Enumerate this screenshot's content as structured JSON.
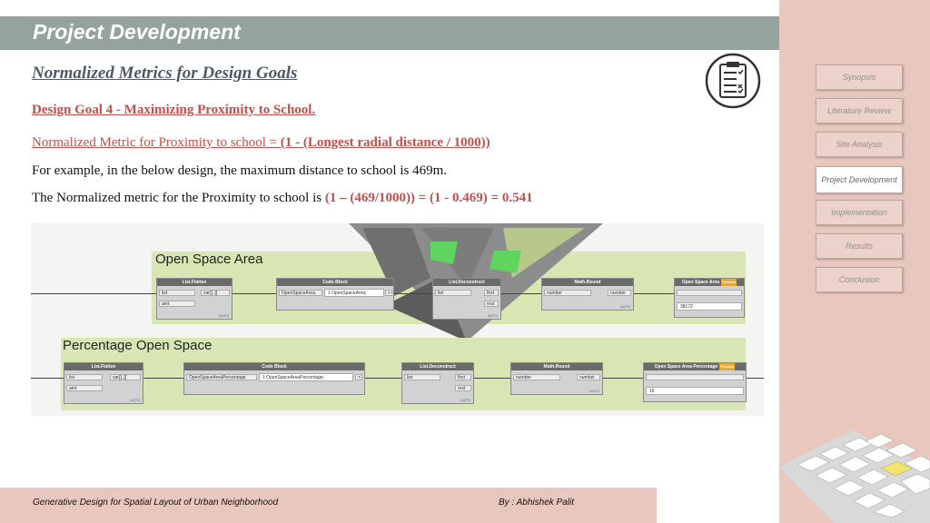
{
  "header": {
    "title": "Project Development"
  },
  "slide": {
    "subtitle": "Normalized Metrics for Design Goals",
    "goal": "Design Goal 4 - Maximizing Proximity to School.",
    "metric_prefix": "Normalized Metric for Proximity to school = ",
    "metric_formula": "(1 - (Longest radial distance / 1000))",
    "example": "For example, in the below design, the maximum distance to school is 469m.",
    "result_prefix": "The Normalized metric for the Proximity to school is ",
    "result_value": "(1 – (469/1000)) = (1 - 0.469) = 0.541"
  },
  "nav": {
    "items": [
      "Synopsis",
      "Literature Review",
      "Site Analysis",
      "Project Development",
      "Implementation",
      "Results",
      "Conclusion"
    ],
    "active": "Project Development"
  },
  "graph": {
    "group1": {
      "title": "Open Space Area",
      "flatten": {
        "title": "List.Flatten",
        "in1": "list",
        "in2": "amt",
        "out": "var[]..[]"
      },
      "code": {
        "title": "Code Block",
        "in": "OpenSpaceArea",
        "code": "1 OpenSpaceArea;",
        "out": ">"
      },
      "deconstruct": {
        "title": "List.Deconstruct",
        "in": "list",
        "out1": "first",
        "out2": "rest"
      },
      "round": {
        "title": "Math.Round",
        "in": "number",
        "out": "number"
      },
      "watch": {
        "title": "Open Space Area",
        "value": "38172"
      }
    },
    "group2": {
      "title": "Percentage Open Space",
      "flatten": {
        "title": "List.Flatten",
        "in1": "list",
        "in2": "amt",
        "out": "var[]..[]"
      },
      "code": {
        "title": "Code Block",
        "in": "OpenSpaceAreaPercentage",
        "code": "1 OpenSpaceAreaPercentage;",
        "out": ">"
      },
      "deconstruct": {
        "title": "List.Deconstruct",
        "in": "list",
        "out1": "first",
        "out2": "rest"
      },
      "round": {
        "title": "Math.Round",
        "in": "number",
        "out": "number"
      },
      "watch": {
        "title": "Open Space Area Percentage",
        "value": "16"
      }
    },
    "auto_label": "AUTO",
    "badge_label": "Preview"
  },
  "footer": {
    "left": "Generative Design for Spatial Layout of Urban Neighborhood",
    "right": "By : Abhishek Palit"
  },
  "colors": {
    "accent_red": "#c0504d",
    "topbar": "#94a39f",
    "panel": "#e8c7be",
    "group_green": "#d8e6b4"
  },
  "icons": {
    "checklist": "checklist-icon"
  }
}
